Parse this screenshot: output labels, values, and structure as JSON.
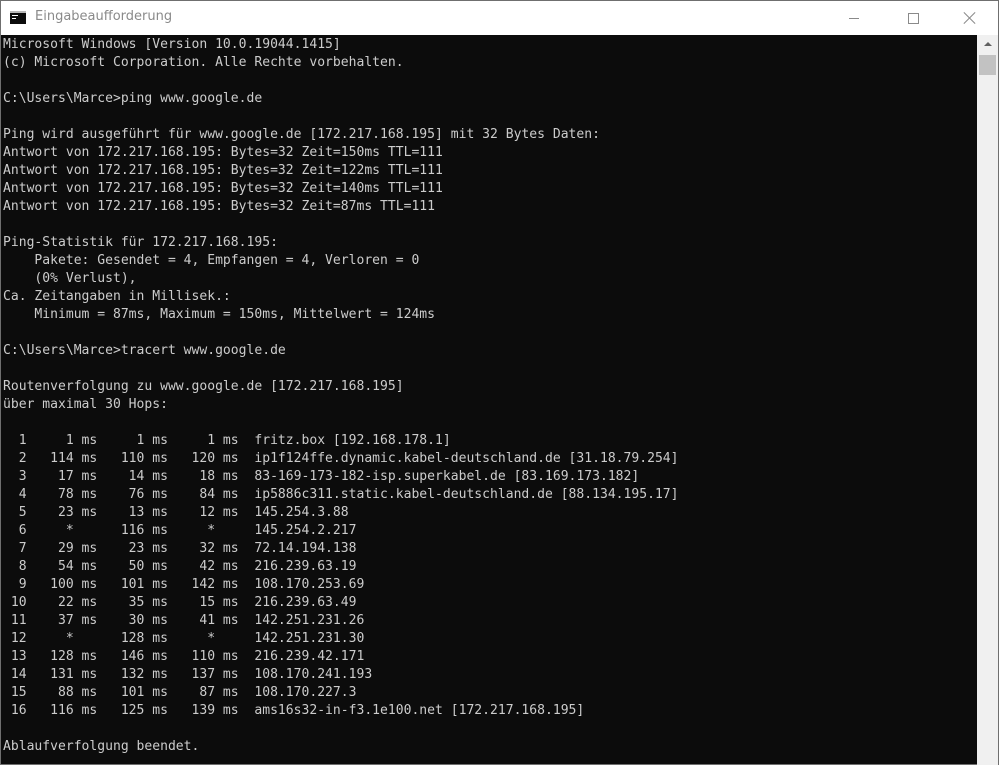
{
  "window": {
    "title": "Eingabeaufforderung",
    "icon": "cmd-icon"
  },
  "console": {
    "lines": [
      "Microsoft Windows [Version 10.0.19044.1415]",
      "(c) Microsoft Corporation. Alle Rechte vorbehalten.",
      "",
      "C:\\Users\\Marce>ping www.google.de",
      "",
      "Ping wird ausgeführt für www.google.de [172.217.168.195] mit 32 Bytes Daten:",
      "Antwort von 172.217.168.195: Bytes=32 Zeit=150ms TTL=111",
      "Antwort von 172.217.168.195: Bytes=32 Zeit=122ms TTL=111",
      "Antwort von 172.217.168.195: Bytes=32 Zeit=140ms TTL=111",
      "Antwort von 172.217.168.195: Bytes=32 Zeit=87ms TTL=111",
      "",
      "Ping-Statistik für 172.217.168.195:",
      "    Pakete: Gesendet = 4, Empfangen = 4, Verloren = 0",
      "    (0% Verlust),",
      "Ca. Zeitangaben in Millisek.:",
      "    Minimum = 87ms, Maximum = 150ms, Mittelwert = 124ms",
      "",
      "C:\\Users\\Marce>tracert www.google.de",
      "",
      "Routenverfolgung zu www.google.de [172.217.168.195]",
      "über maximal 30 Hops:",
      "",
      "  1     1 ms     1 ms     1 ms  fritz.box [192.168.178.1]",
      "  2   114 ms   110 ms   120 ms  ip1f124ffe.dynamic.kabel-deutschland.de [31.18.79.254]",
      "  3    17 ms    14 ms    18 ms  83-169-173-182-isp.superkabel.de [83.169.173.182]",
      "  4    78 ms    76 ms    84 ms  ip5886c311.static.kabel-deutschland.de [88.134.195.17]",
      "  5    23 ms    13 ms    12 ms  145.254.3.88",
      "  6     *      116 ms     *     145.254.2.217",
      "  7    29 ms    23 ms    32 ms  72.14.194.138",
      "  8    54 ms    50 ms    42 ms  216.239.63.19",
      "  9   100 ms   101 ms   142 ms  108.170.253.69",
      " 10    22 ms    35 ms    15 ms  216.239.63.49",
      " 11    37 ms    30 ms    41 ms  142.251.231.26",
      " 12     *      128 ms     *     142.251.231.30",
      " 13   128 ms   146 ms   110 ms  216.239.42.171",
      " 14   131 ms   132 ms   137 ms  108.170.241.193",
      " 15    88 ms   101 ms    87 ms  108.170.227.3",
      " 16   116 ms   125 ms   139 ms  ams16s32-in-f3.1e100.net [172.217.168.195]",
      "",
      "Ablaufverfolgung beendet."
    ]
  },
  "colors": {
    "console_bg": "#0c0c0c",
    "console_fg": "#cccccc",
    "titlebar_bg": "#ffffff"
  }
}
